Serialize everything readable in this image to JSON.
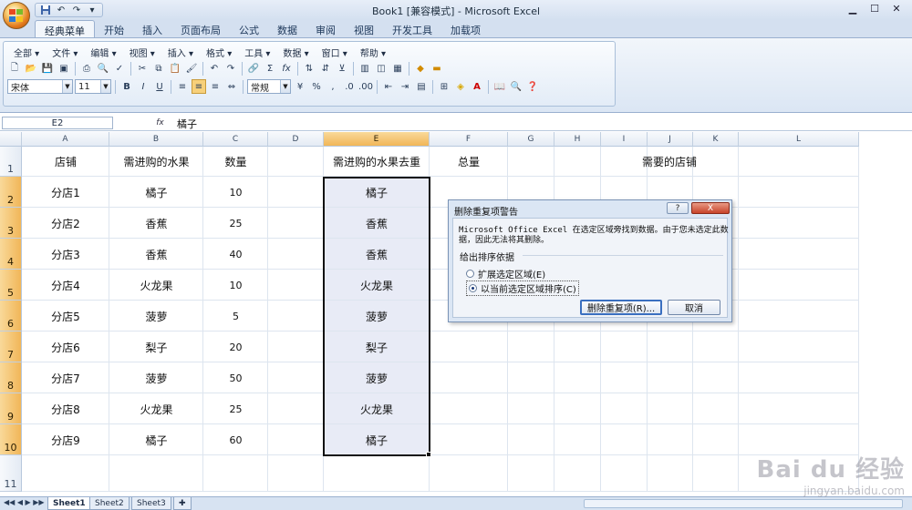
{
  "window": {
    "title": "Book1  [兼容模式] - Microsoft Excel"
  },
  "ribbon_tabs": [
    "经典菜单",
    "开始",
    "插入",
    "页面布局",
    "公式",
    "数据",
    "审阅",
    "视图",
    "开发工具",
    "加载项"
  ],
  "classic_menu": [
    "全部 ▾",
    "文件 ▾",
    "编辑 ▾",
    "视图 ▾",
    "插入 ▾",
    "格式 ▾",
    "工具 ▾",
    "数据 ▾",
    "窗口 ▾",
    "帮助 ▾"
  ],
  "format_bar": {
    "font_name": "宋体",
    "font_size": "11",
    "number_format": "常规"
  },
  "formula_bar": {
    "name_box": "E2",
    "fx_label": "fx",
    "content": "橘子"
  },
  "columns": [
    "A",
    "B",
    "C",
    "D",
    "E",
    "F",
    "G",
    "H",
    "I",
    "J",
    "K",
    "L"
  ],
  "rows": [
    "1",
    "2",
    "3",
    "4",
    "5",
    "6",
    "7",
    "8",
    "9",
    "10",
    "11"
  ],
  "headers": {
    "a1": "店铺",
    "b1": "需进购的水果",
    "c1": "数量",
    "e1": "需进购的水果去重",
    "f1": "总量",
    "hk1": "需要的店铺"
  },
  "table": [
    {
      "store": "分店1",
      "fruit": "橘子",
      "qty": "10",
      "dedup": "橘子"
    },
    {
      "store": "分店2",
      "fruit": "香蕉",
      "qty": "25",
      "dedup": "香蕉"
    },
    {
      "store": "分店3",
      "fruit": "香蕉",
      "qty": "40",
      "dedup": "香蕉"
    },
    {
      "store": "分店4",
      "fruit": "火龙果",
      "qty": "10",
      "dedup": "火龙果"
    },
    {
      "store": "分店5",
      "fruit": "菠萝",
      "qty": "5",
      "dedup": "菠萝"
    },
    {
      "store": "分店6",
      "fruit": "梨子",
      "qty": "20",
      "dedup": "梨子"
    },
    {
      "store": "分店7",
      "fruit": "菠萝",
      "qty": "50",
      "dedup": "菠萝"
    },
    {
      "store": "分店8",
      "fruit": "火龙果",
      "qty": "25",
      "dedup": "火龙果"
    },
    {
      "store": "分店9",
      "fruit": "橘子",
      "qty": "60",
      "dedup": "橘子"
    }
  ],
  "sheet_tabs": [
    "Sheet1",
    "Sheet2",
    "Sheet3"
  ],
  "dialog": {
    "title": "删除重复项警告",
    "help": "?",
    "close": "X",
    "message_line1": "Microsoft Office Excel 在选定区域旁找到数据。由于您未选定此数",
    "message_line2": "据，因此无法将其删除。",
    "group_label": "给出排序依据",
    "option_expand": "扩展选定区域(E)",
    "option_current": "以当前选定区域排序(C)",
    "btn_remove": "删除重复项(R)...",
    "btn_cancel": "取消"
  },
  "watermark": {
    "logo": "Bai du 经验",
    "url": "jingyan.baidu.com"
  },
  "colors": {
    "selected_header": "#f1b658",
    "selection_fill": "#e8ebf6",
    "ribbon_bg": "#dbe6f4"
  }
}
